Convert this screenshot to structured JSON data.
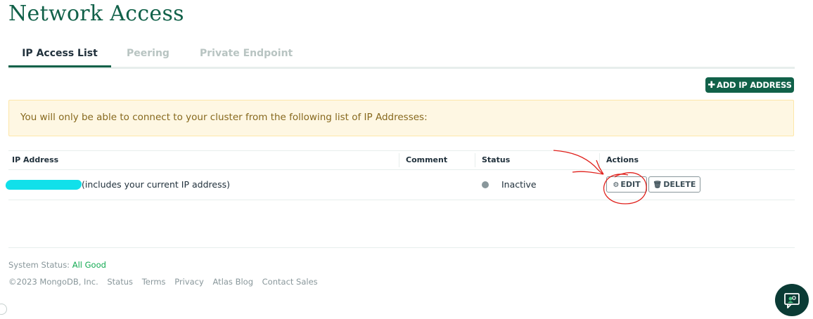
{
  "page": {
    "title": "Network Access"
  },
  "tabs": [
    {
      "label": "IP Access List",
      "active": true
    },
    {
      "label": "Peering",
      "active": false
    },
    {
      "label": "Private Endpoint",
      "active": false
    }
  ],
  "toolbar": {
    "add_label": "ADD IP ADDRESS",
    "add_icon": "plus-icon"
  },
  "banner": {
    "text": "You will only be able to connect to your cluster from the following list of IP Addresses:"
  },
  "table": {
    "columns": [
      "IP Address",
      "Comment",
      "Status",
      "Actions"
    ],
    "rows": [
      {
        "ip_note": "(includes your current IP address)",
        "comment": "",
        "status": "Inactive",
        "status_color": "#89979b",
        "edit_label": "EDIT",
        "delete_label": "DELETE"
      }
    ]
  },
  "footer": {
    "system_status_label": "System Status:",
    "system_status_value": "All Good",
    "copyright": "©2023 MongoDB, Inc.",
    "links": [
      "Status",
      "Terms",
      "Privacy",
      "Atlas Blog",
      "Contact Sales"
    ]
  },
  "colors": {
    "brand": "#116149",
    "accent_green": "#13aa52",
    "banner_bg": "#fef7e3",
    "redaction": "#11e0ea",
    "annotation": "#e0201b"
  },
  "icons": {
    "edit": "gear-icon",
    "delete": "trash-icon",
    "chat": "chat-support-icon"
  }
}
